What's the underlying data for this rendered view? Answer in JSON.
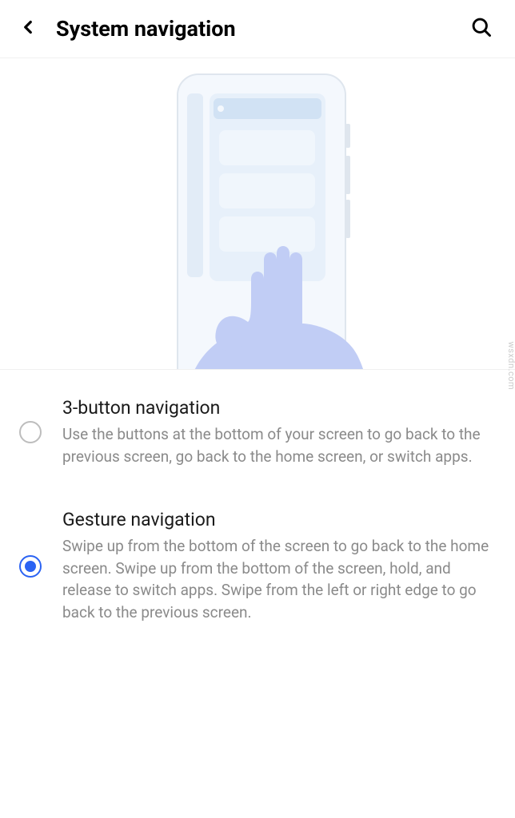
{
  "header": {
    "title": "System navigation"
  },
  "options": [
    {
      "title": "3-button navigation",
      "description": "Use the buttons at the bottom of your screen to go back to the previous screen, go back to the home screen, or switch apps.",
      "selected": false
    },
    {
      "title": "Gesture navigation",
      "description": "Swipe up from the bottom of the screen to go back to the home screen. Swipe up from the bottom of the screen, hold, and release to switch apps. Swipe from the left or right edge to go back to the previous screen.",
      "selected": true
    }
  ],
  "watermark": "wsxdn.com"
}
